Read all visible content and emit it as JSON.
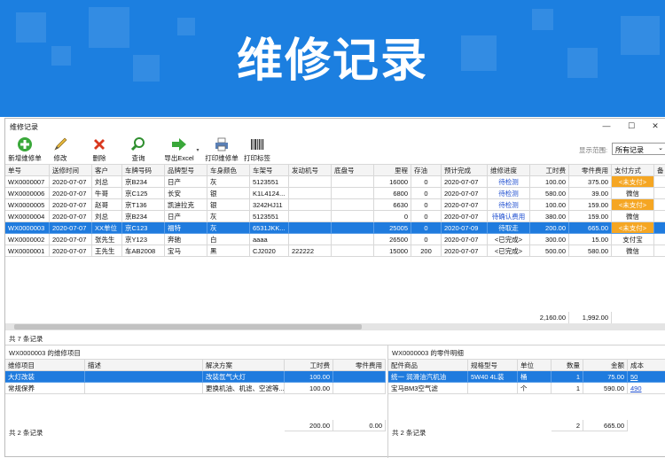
{
  "banner": {
    "title": "维修记录",
    "color": "#1c7fe0"
  },
  "window": {
    "title": "维修记录",
    "minimize": "—",
    "maximize": "☐",
    "close": "✕"
  },
  "toolbar": {
    "buttons": [
      {
        "label": "新增维修单",
        "icon": "add-icon"
      },
      {
        "label": "修改",
        "icon": "pencil-icon"
      },
      {
        "label": "删除",
        "icon": "delete-icon"
      },
      {
        "label": "查询",
        "icon": "magnifier-icon"
      },
      {
        "label": "导出Excel",
        "icon": "arrow-right-icon"
      },
      {
        "label": "打印维修单",
        "icon": "printer-icon"
      },
      {
        "label": "打印标签",
        "icon": "barcode-icon"
      }
    ],
    "range_label": "显示范围:",
    "range_value": "所有记录"
  },
  "main_grid": {
    "headers": [
      "单号",
      "送修时间",
      "客户",
      "车牌号码",
      "品牌型号",
      "车身颜色",
      "车架号",
      "发动机号",
      "底盘号",
      "里程",
      "存油",
      "预计完成",
      "维修进度",
      "工时费",
      "零件费用",
      "支付方式",
      "备"
    ],
    "rows": [
      [
        "WX0000007",
        "2020-07-07",
        "刘总",
        "京B234",
        "日产",
        "灰",
        "5123551",
        "",
        "",
        "16000",
        "0",
        "2020-07-07",
        "待检测",
        "100.00",
        "375.00",
        "<未支付>",
        ""
      ],
      [
        "WX0000006",
        "2020-07-07",
        "牛哥",
        "京C125",
        "长安",
        "银",
        "K1L4124...",
        "",
        "",
        "6800",
        "0",
        "2020-07-07",
        "待检测",
        "580.00",
        "39.00",
        "微信",
        ""
      ],
      [
        "WX0000005",
        "2020-07-07",
        "赵哥",
        "京T136",
        "凯迪拉克",
        "银",
        "3242HJ11",
        "",
        "",
        "6630",
        "0",
        "2020-07-07",
        "待检测",
        "100.00",
        "159.00",
        "<未支付>",
        ""
      ],
      [
        "WX0000004",
        "2020-07-07",
        "刘总",
        "京B234",
        "日产",
        "灰",
        "5123551",
        "",
        "",
        "0",
        "0",
        "2020-07-07",
        "待确认费用",
        "380.00",
        "159.00",
        "微信",
        ""
      ],
      [
        "WX0000003",
        "2020-07-07",
        "XX单位",
        "京C123",
        "福特",
        "灰",
        "6531JKK...",
        "",
        "",
        "25005",
        "0",
        "2020-07-09",
        "待取走",
        "200.00",
        "665.00",
        "<未支付>",
        ""
      ],
      [
        "WX0000002",
        "2020-07-07",
        "张先生",
        "京Y123",
        "奔驰",
        "白",
        "aaaa",
        "",
        "",
        "26500",
        "0",
        "2020-07-07",
        "<已完成>",
        "300.00",
        "15.00",
        "支付宝",
        ""
      ],
      [
        "WX0000001",
        "2020-07-07",
        "王先生",
        "车AB2008",
        "宝马",
        "黑",
        "CJ2020",
        "222222",
        "",
        "15000",
        "200",
        "2020-07-07",
        "<已完成>",
        "500.00",
        "580.00",
        "微信",
        ""
      ]
    ],
    "totals": {
      "labor": "2,160.00",
      "parts": "1,992.00"
    },
    "count": "共 7 条记录"
  },
  "items_panel": {
    "title": "WX0000003 的维修项目",
    "headers": [
      "维修项目",
      "描述",
      "解决方案",
      "工时费",
      "零件费用"
    ],
    "rows": [
      [
        "大灯改装",
        "",
        "改装氙气大灯",
        "100.00",
        ""
      ],
      [
        "常规保养",
        "",
        "更换机油、机滤、空滤等...",
        "100.00",
        ""
      ]
    ],
    "totals": {
      "labor": "200.00",
      "parts": "0.00"
    },
    "count": "共 2 条记录"
  },
  "parts_panel": {
    "title": "WX0000003 的零件明细",
    "headers": [
      "配件商品",
      "规格型号",
      "单位",
      "数量",
      "金额",
      "成本"
    ],
    "rows": [
      [
        "统一 润滑油汽机油",
        "5W40 4L装",
        "桶",
        "1",
        "75.00",
        "50"
      ],
      [
        "宝马BM3空气滤",
        "",
        "个",
        "1",
        "590.00",
        "490"
      ]
    ],
    "totals": {
      "qty": "2",
      "amount": "665.00"
    },
    "count": "共 2 条记录"
  }
}
